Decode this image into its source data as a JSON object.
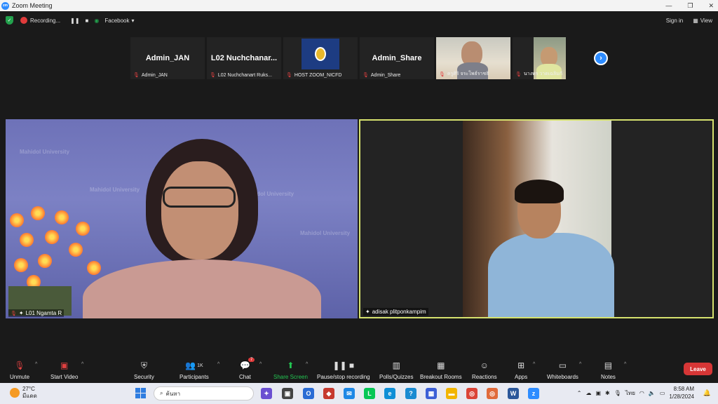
{
  "window": {
    "title": "Zoom Meeting",
    "minimize": "—",
    "maximize": "❐",
    "close": "✕"
  },
  "topbar": {
    "recording_label": "Recording...",
    "pause_icon": "❚❚",
    "stop_icon": "■",
    "facebook_label": "Facebook",
    "sign_in": "Sign in",
    "view": "View"
  },
  "strip": [
    {
      "big": "Admin_JAN",
      "name": "Admin_JAN"
    },
    {
      "big": "L02  Nuchchanar...",
      "name": "L02 Nuchchanart Ruks..."
    },
    {
      "big": "",
      "name": "HOST ZOOM_NICFD"
    },
    {
      "big": "Admin_Share",
      "name": "Admin_Share"
    },
    {
      "big": "",
      "name": "ครูศิริ จระโพธ์ราชธิ"
    },
    {
      "big": "",
      "name": "นางพร วาดเฉลิมกั"
    }
  ],
  "main_video": {
    "name": "L01 Ngamta R",
    "watermark": "Mahidol University"
  },
  "active_video": {
    "name": "adisak plitponkampim"
  },
  "toolbar": {
    "unmute": "Unmute",
    "start_video": "Start Video",
    "security": "Security",
    "participants": "Participants",
    "participants_count": "1K",
    "chat": "Chat",
    "chat_badge": "7",
    "share_screen": "Share Screen",
    "pause_recording": "Pause/stop recording",
    "polls": "Polls/Quizzes",
    "breakout": "Breakout Rooms",
    "reactions": "Reactions",
    "apps": "Apps",
    "whiteboards": "Whiteboards",
    "notes": "Notes",
    "leave": "Leave"
  },
  "taskbar": {
    "temperature": "27°C",
    "weather_text": "มีแดด",
    "search_placeholder": "ค้นหา",
    "lang": "ไทย",
    "time": "8:58 AM",
    "date": "1/28/2024"
  },
  "colors": {
    "accent": "#2d8cff",
    "leave": "#d63636",
    "active_border": "#d6e26e"
  }
}
